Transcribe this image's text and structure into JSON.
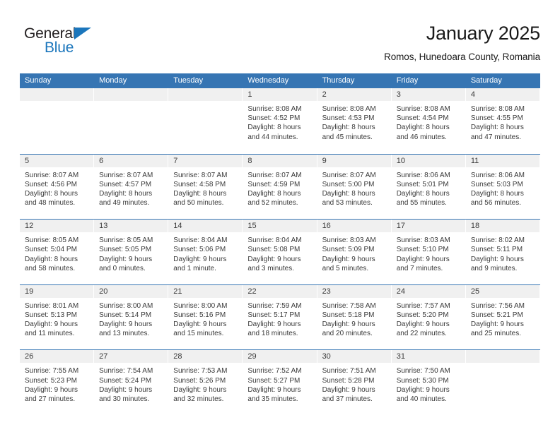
{
  "logo": {
    "word_black": "General",
    "word_blue": "Blue",
    "triangle_color": "#1b76bc"
  },
  "header": {
    "title": "January 2025",
    "subtitle": "Romos, Hunedoara County, Romania"
  },
  "theme": {
    "header_blue": "#3675b3",
    "daynum_bg": "#f0f0f0",
    "text": "#3a3a3a"
  },
  "weekdays": [
    "Sunday",
    "Monday",
    "Tuesday",
    "Wednesday",
    "Thursday",
    "Friday",
    "Saturday"
  ],
  "weeks": [
    [
      {
        "day": "",
        "empty": true
      },
      {
        "day": "",
        "empty": true
      },
      {
        "day": "",
        "empty": true
      },
      {
        "day": "1",
        "sunrise": "Sunrise: 8:08 AM",
        "sunset": "Sunset: 4:52 PM",
        "daylight1": "Daylight: 8 hours",
        "daylight2": "and 44 minutes."
      },
      {
        "day": "2",
        "sunrise": "Sunrise: 8:08 AM",
        "sunset": "Sunset: 4:53 PM",
        "daylight1": "Daylight: 8 hours",
        "daylight2": "and 45 minutes."
      },
      {
        "day": "3",
        "sunrise": "Sunrise: 8:08 AM",
        "sunset": "Sunset: 4:54 PM",
        "daylight1": "Daylight: 8 hours",
        "daylight2": "and 46 minutes."
      },
      {
        "day": "4",
        "sunrise": "Sunrise: 8:08 AM",
        "sunset": "Sunset: 4:55 PM",
        "daylight1": "Daylight: 8 hours",
        "daylight2": "and 47 minutes."
      }
    ],
    [
      {
        "day": "5",
        "sunrise": "Sunrise: 8:07 AM",
        "sunset": "Sunset: 4:56 PM",
        "daylight1": "Daylight: 8 hours",
        "daylight2": "and 48 minutes."
      },
      {
        "day": "6",
        "sunrise": "Sunrise: 8:07 AM",
        "sunset": "Sunset: 4:57 PM",
        "daylight1": "Daylight: 8 hours",
        "daylight2": "and 49 minutes."
      },
      {
        "day": "7",
        "sunrise": "Sunrise: 8:07 AM",
        "sunset": "Sunset: 4:58 PM",
        "daylight1": "Daylight: 8 hours",
        "daylight2": "and 50 minutes."
      },
      {
        "day": "8",
        "sunrise": "Sunrise: 8:07 AM",
        "sunset": "Sunset: 4:59 PM",
        "daylight1": "Daylight: 8 hours",
        "daylight2": "and 52 minutes."
      },
      {
        "day": "9",
        "sunrise": "Sunrise: 8:07 AM",
        "sunset": "Sunset: 5:00 PM",
        "daylight1": "Daylight: 8 hours",
        "daylight2": "and 53 minutes."
      },
      {
        "day": "10",
        "sunrise": "Sunrise: 8:06 AM",
        "sunset": "Sunset: 5:01 PM",
        "daylight1": "Daylight: 8 hours",
        "daylight2": "and 55 minutes."
      },
      {
        "day": "11",
        "sunrise": "Sunrise: 8:06 AM",
        "sunset": "Sunset: 5:03 PM",
        "daylight1": "Daylight: 8 hours",
        "daylight2": "and 56 minutes."
      }
    ],
    [
      {
        "day": "12",
        "sunrise": "Sunrise: 8:05 AM",
        "sunset": "Sunset: 5:04 PM",
        "daylight1": "Daylight: 8 hours",
        "daylight2": "and 58 minutes."
      },
      {
        "day": "13",
        "sunrise": "Sunrise: 8:05 AM",
        "sunset": "Sunset: 5:05 PM",
        "daylight1": "Daylight: 9 hours",
        "daylight2": "and 0 minutes."
      },
      {
        "day": "14",
        "sunrise": "Sunrise: 8:04 AM",
        "sunset": "Sunset: 5:06 PM",
        "daylight1": "Daylight: 9 hours",
        "daylight2": "and 1 minute."
      },
      {
        "day": "15",
        "sunrise": "Sunrise: 8:04 AM",
        "sunset": "Sunset: 5:08 PM",
        "daylight1": "Daylight: 9 hours",
        "daylight2": "and 3 minutes."
      },
      {
        "day": "16",
        "sunrise": "Sunrise: 8:03 AM",
        "sunset": "Sunset: 5:09 PM",
        "daylight1": "Daylight: 9 hours",
        "daylight2": "and 5 minutes."
      },
      {
        "day": "17",
        "sunrise": "Sunrise: 8:03 AM",
        "sunset": "Sunset: 5:10 PM",
        "daylight1": "Daylight: 9 hours",
        "daylight2": "and 7 minutes."
      },
      {
        "day": "18",
        "sunrise": "Sunrise: 8:02 AM",
        "sunset": "Sunset: 5:11 PM",
        "daylight1": "Daylight: 9 hours",
        "daylight2": "and 9 minutes."
      }
    ],
    [
      {
        "day": "19",
        "sunrise": "Sunrise: 8:01 AM",
        "sunset": "Sunset: 5:13 PM",
        "daylight1": "Daylight: 9 hours",
        "daylight2": "and 11 minutes."
      },
      {
        "day": "20",
        "sunrise": "Sunrise: 8:00 AM",
        "sunset": "Sunset: 5:14 PM",
        "daylight1": "Daylight: 9 hours",
        "daylight2": "and 13 minutes."
      },
      {
        "day": "21",
        "sunrise": "Sunrise: 8:00 AM",
        "sunset": "Sunset: 5:16 PM",
        "daylight1": "Daylight: 9 hours",
        "daylight2": "and 15 minutes."
      },
      {
        "day": "22",
        "sunrise": "Sunrise: 7:59 AM",
        "sunset": "Sunset: 5:17 PM",
        "daylight1": "Daylight: 9 hours",
        "daylight2": "and 18 minutes."
      },
      {
        "day": "23",
        "sunrise": "Sunrise: 7:58 AM",
        "sunset": "Sunset: 5:18 PM",
        "daylight1": "Daylight: 9 hours",
        "daylight2": "and 20 minutes."
      },
      {
        "day": "24",
        "sunrise": "Sunrise: 7:57 AM",
        "sunset": "Sunset: 5:20 PM",
        "daylight1": "Daylight: 9 hours",
        "daylight2": "and 22 minutes."
      },
      {
        "day": "25",
        "sunrise": "Sunrise: 7:56 AM",
        "sunset": "Sunset: 5:21 PM",
        "daylight1": "Daylight: 9 hours",
        "daylight2": "and 25 minutes."
      }
    ],
    [
      {
        "day": "26",
        "sunrise": "Sunrise: 7:55 AM",
        "sunset": "Sunset: 5:23 PM",
        "daylight1": "Daylight: 9 hours",
        "daylight2": "and 27 minutes."
      },
      {
        "day": "27",
        "sunrise": "Sunrise: 7:54 AM",
        "sunset": "Sunset: 5:24 PM",
        "daylight1": "Daylight: 9 hours",
        "daylight2": "and 30 minutes."
      },
      {
        "day": "28",
        "sunrise": "Sunrise: 7:53 AM",
        "sunset": "Sunset: 5:26 PM",
        "daylight1": "Daylight: 9 hours",
        "daylight2": "and 32 minutes."
      },
      {
        "day": "29",
        "sunrise": "Sunrise: 7:52 AM",
        "sunset": "Sunset: 5:27 PM",
        "daylight1": "Daylight: 9 hours",
        "daylight2": "and 35 minutes."
      },
      {
        "day": "30",
        "sunrise": "Sunrise: 7:51 AM",
        "sunset": "Sunset: 5:28 PM",
        "daylight1": "Daylight: 9 hours",
        "daylight2": "and 37 minutes."
      },
      {
        "day": "31",
        "sunrise": "Sunrise: 7:50 AM",
        "sunset": "Sunset: 5:30 PM",
        "daylight1": "Daylight: 9 hours",
        "daylight2": "and 40 minutes."
      },
      {
        "day": "",
        "empty": true
      }
    ]
  ]
}
